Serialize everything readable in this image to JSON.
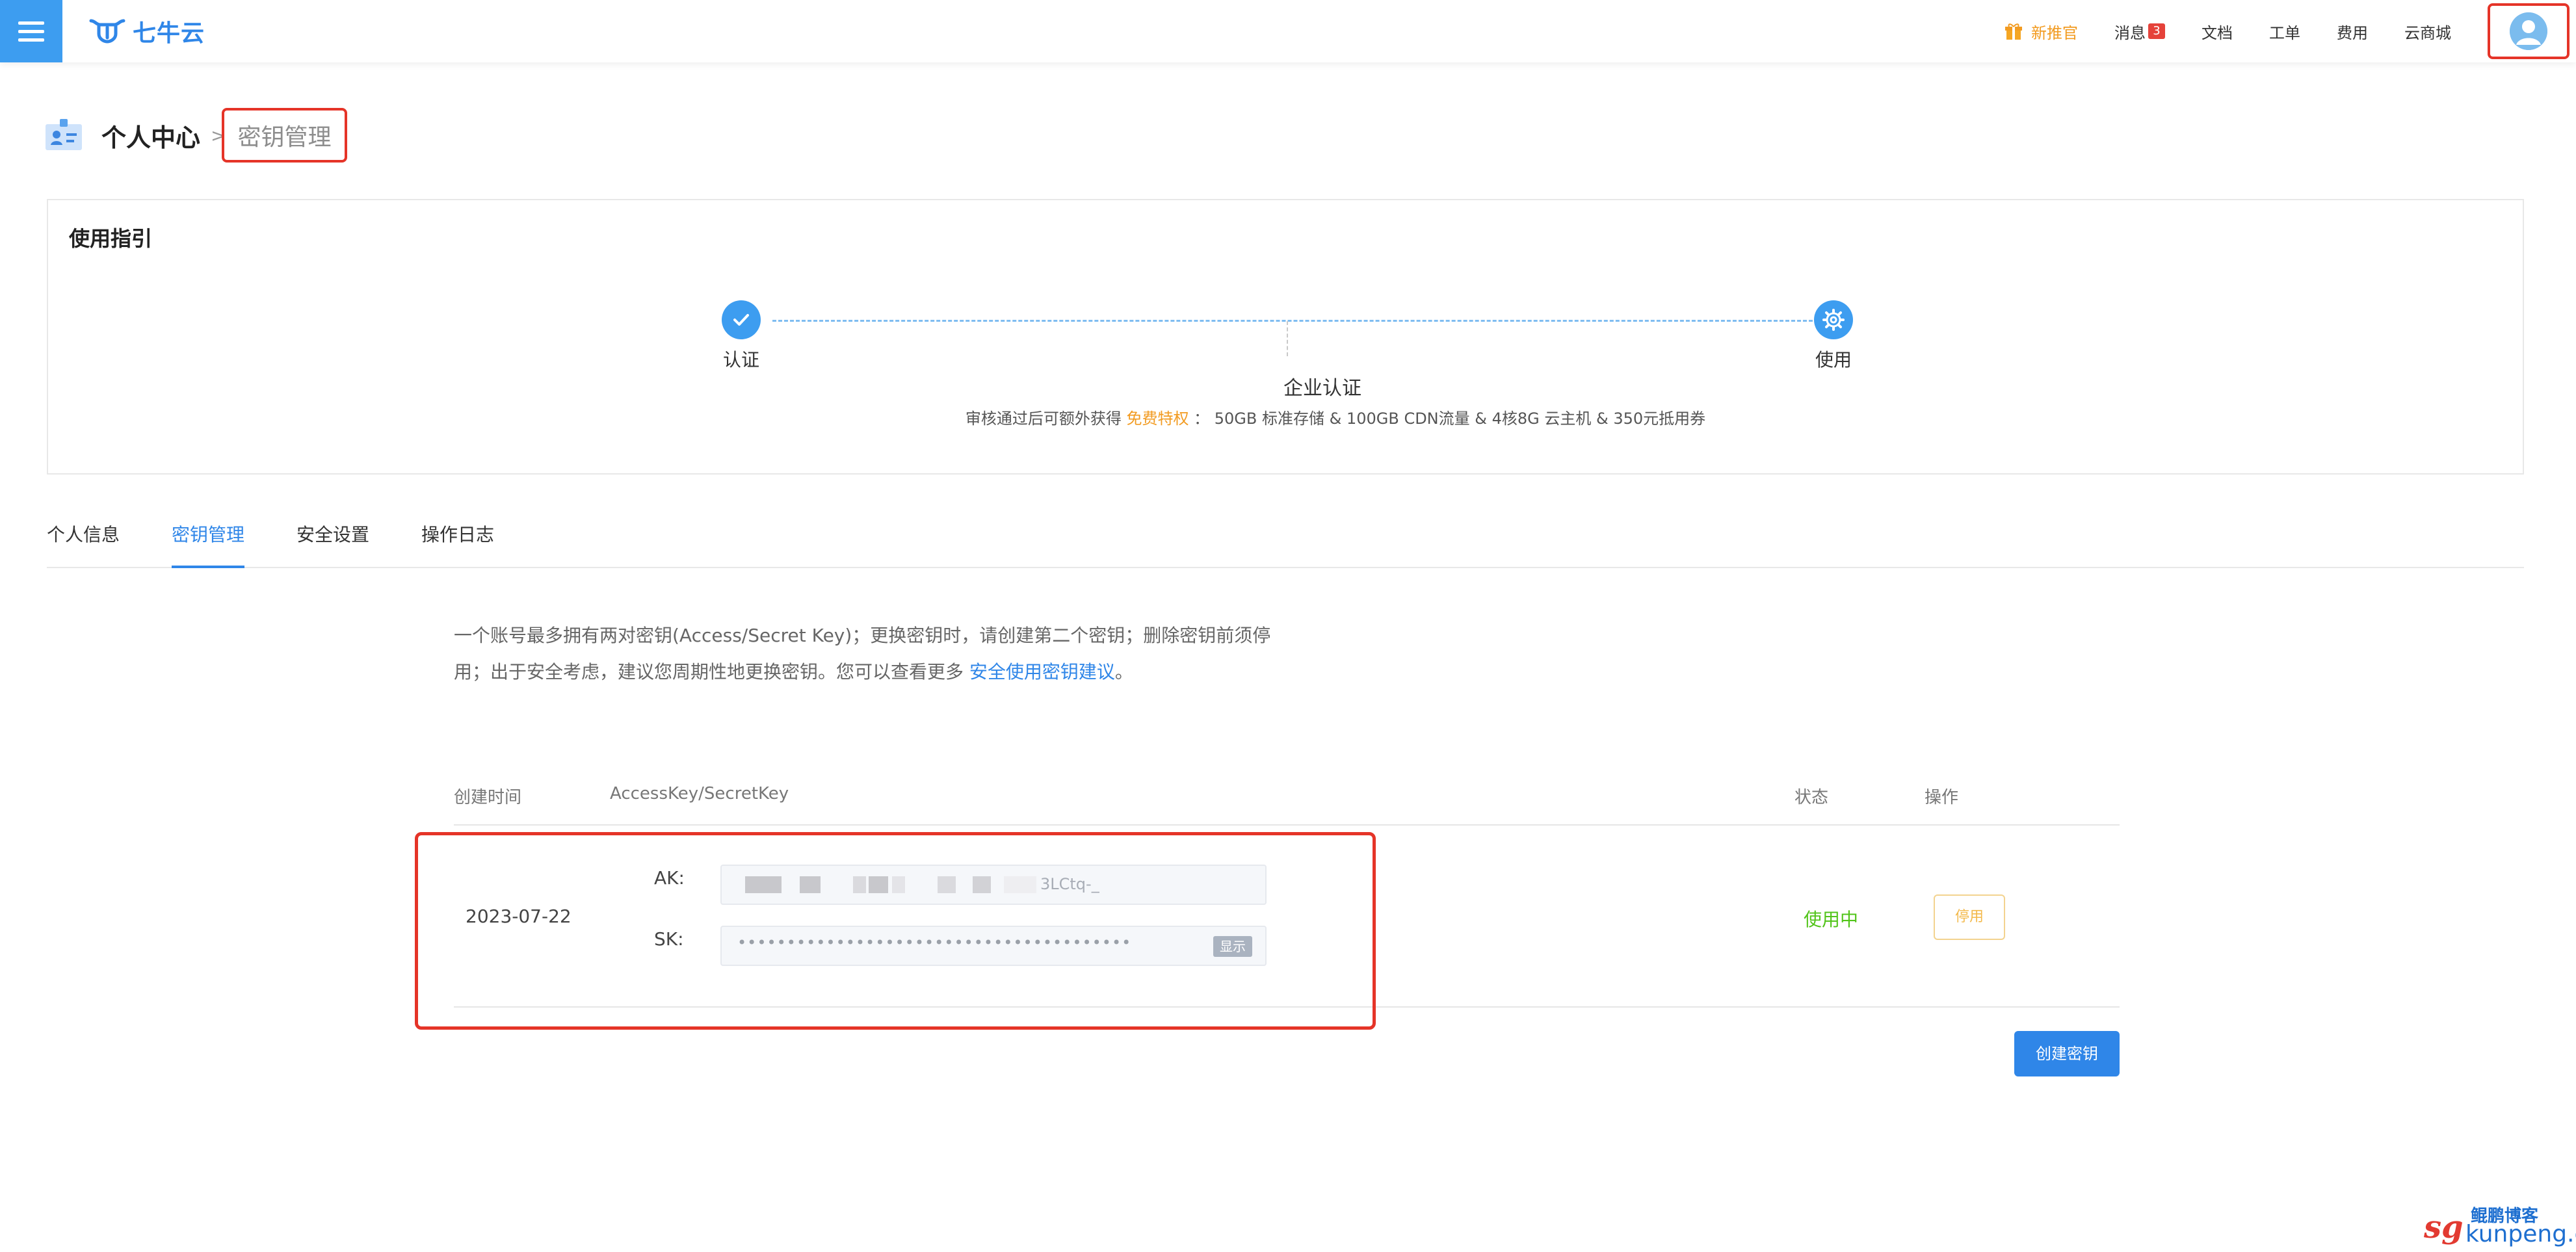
{
  "topbar": {
    "logo_text": "七牛云",
    "nav": {
      "promo": "新推官",
      "messages": "消息",
      "messages_badge": "3",
      "docs": "文档",
      "tickets": "工单",
      "billing": "费用",
      "marketplace": "云商城"
    }
  },
  "breadcrumb": {
    "root": "个人中心",
    "separator": ">",
    "current": "密钥管理"
  },
  "guide": {
    "title": "使用指引",
    "step1": "认证",
    "step2": "使用",
    "middle_title": "企业认证",
    "desc_prefix": "审核通过后可额外获得",
    "desc_highlight": "免费特权",
    "desc_suffix": "：  50GB 标准存储 & 100GB CDN流量 & 4核8G 云主机 & 350元抵用券"
  },
  "tabs": [
    "个人信息",
    "密钥管理",
    "安全设置",
    "操作日志"
  ],
  "intro": {
    "text": "一个账号最多拥有两对密钥(Access/Secret Key)；更换密钥时，请创建第二个密钥；删除密钥前须停用；出于安全考虑，建议您周期性地更换密钥。您可以查看更多 ",
    "link": "安全使用密钥建议",
    "end": "。"
  },
  "table": {
    "headers": {
      "created": "创建时间",
      "keys": "AccessKey/SecretKey",
      "status": "状态",
      "action": "操作"
    },
    "rows": [
      {
        "created": "2023-07-22",
        "ak_label": "AK:",
        "ak_visible_tail": "3LCtq-_",
        "sk_label": "SK:",
        "sk_masked": "••••••••••••••••••••••••••••••••••••••••",
        "show_label": "显示",
        "status": "使用中",
        "action": "停用"
      }
    ]
  },
  "create_button": "创建密钥",
  "watermark": {
    "sg": "sg",
    "name": "鲲鹏博客",
    "domain": "kunpeng.cn"
  },
  "colors": {
    "primary": "#2f86e8",
    "menu_bg": "#3d9df0",
    "accent_orange": "#f29b21",
    "status_green": "#52c41a",
    "highlight_red": "#e53428"
  }
}
